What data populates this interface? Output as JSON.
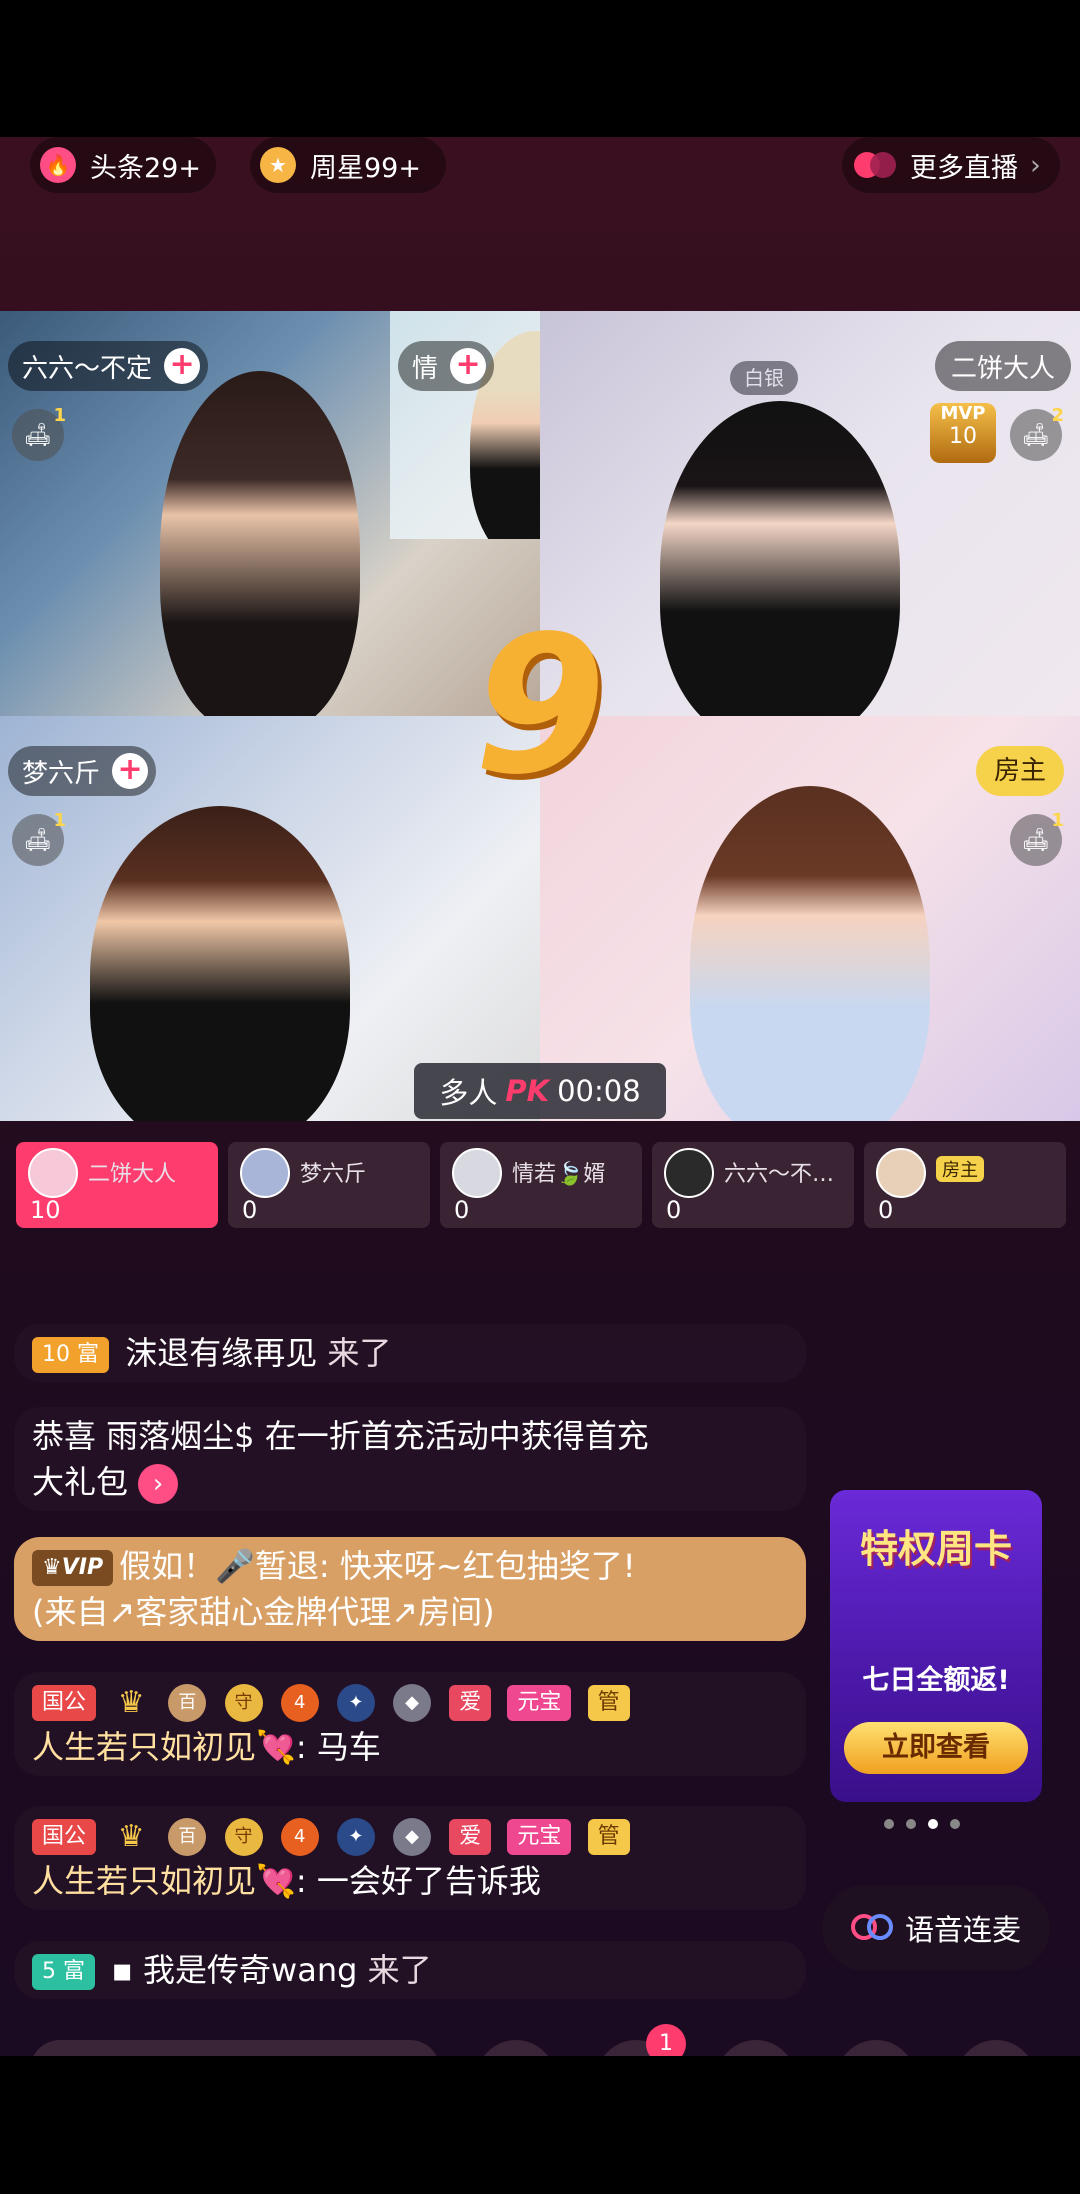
{
  "top_bar": {
    "headlines_label": "头条29+",
    "weekly_star_label": "周星99+",
    "more_live_label": "更多直播",
    "more_live_chevron": "›"
  },
  "grid": {
    "cells": [
      {
        "name": "六六～不定",
        "plus": "+",
        "sofa_count": "1"
      },
      {
        "name": "情",
        "plus": "+"
      },
      {
        "name": "二饼大人",
        "badge": "白银",
        "mvp_label": "MVP",
        "mvp_score": "10",
        "sofa_count": "2"
      },
      {
        "name": "梦六斤",
        "plus": "+",
        "sofa_count": "1"
      },
      {
        "name": "房主",
        "sofa_count": "1"
      }
    ],
    "countdown": "9",
    "pk_label": "多人",
    "pk_logo": "PK",
    "pk_timer": "00:08"
  },
  "scores": [
    {
      "name": "二饼大人",
      "score": "10",
      "active": true
    },
    {
      "name": "梦六斤",
      "score": "0"
    },
    {
      "name": "情若🍃婿",
      "score": "0"
    },
    {
      "name": "六六～不…",
      "score": "0"
    },
    {
      "name": "房主",
      "score": "0",
      "host_tag": true
    }
  ],
  "chat": [
    {
      "level": "10",
      "tag": "富",
      "text": "沫退有缘再见",
      "suffix": "来了"
    },
    {
      "line1": "恭喜 雨落烟尘$ 在一折首充活动中获得首充",
      "line2": "大礼包"
    },
    {
      "vip": "VIP",
      "line1": "假如！🎤暂退: 快来呀~红包抽奖了!",
      "line2": "(来自↗客家甜心金牌代理↗房间)"
    },
    {
      "badges": [
        "国公",
        "守",
        "爱",
        "元宝",
        "管"
      ],
      "user": "人生若只如初见💘",
      "text": ": 马车"
    },
    {
      "badges": [
        "国公",
        "守",
        "爱",
        "元宝",
        "管"
      ],
      "user": "人生若只如初见💘",
      "text": ": 一会好了告诉我"
    },
    {
      "level": "5",
      "tag": "富",
      "text": "▪ 我是传奇wang",
      "suffix": "来了"
    }
  ],
  "promo": {
    "title": "特权周卡",
    "subtitle": "七日全额返!",
    "button": "立即查看"
  },
  "voice_button": "语音连麦",
  "notification_count": "1",
  "colors": {
    "accent_pink": "#ff3c6e",
    "gold": "#f6b544",
    "promo_purple": "#5a22c8"
  }
}
